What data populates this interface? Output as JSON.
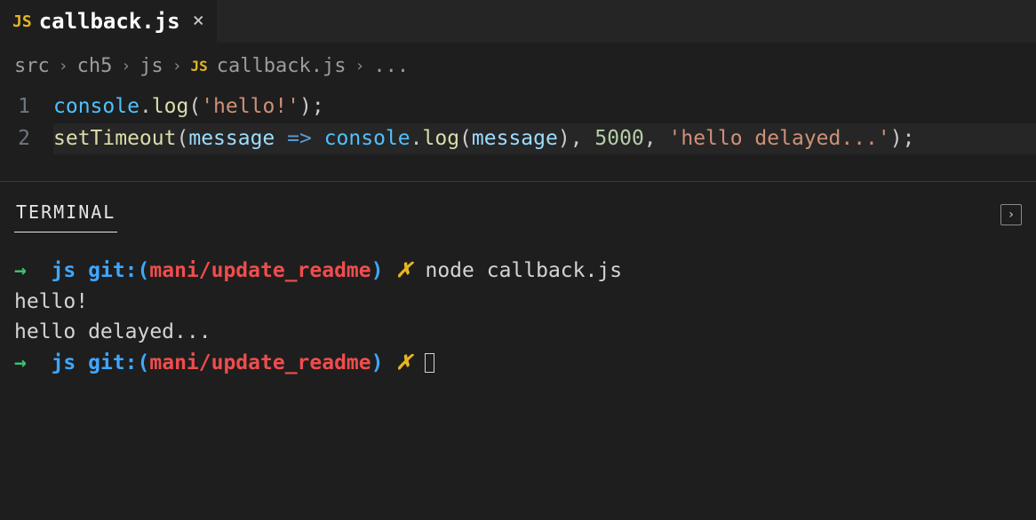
{
  "tab": {
    "icon_label": "JS",
    "filename": "callback.js"
  },
  "breadcrumb": {
    "parts": [
      "src",
      "ch5",
      "js"
    ],
    "file_icon": "JS",
    "filename": "callback.js",
    "trailing": "..."
  },
  "editor": {
    "lines": [
      {
        "num": "1",
        "tokens": [
          {
            "t": "console",
            "c": "tok-obj"
          },
          {
            "t": ".",
            "c": "tok-punct"
          },
          {
            "t": "log",
            "c": "tok-method"
          },
          {
            "t": "(",
            "c": "tok-punct"
          },
          {
            "t": "'hello!'",
            "c": "tok-str"
          },
          {
            "t": ")",
            "c": "tok-punct"
          },
          {
            "t": ";",
            "c": "tok-punct"
          }
        ]
      },
      {
        "num": "2",
        "highlight": true,
        "tokens": [
          {
            "t": "setTimeout",
            "c": "tok-method"
          },
          {
            "t": "(",
            "c": "tok-punct"
          },
          {
            "t": "message",
            "c": "tok-param"
          },
          {
            "t": " ",
            "c": "tok-punct"
          },
          {
            "t": "=>",
            "c": "tok-arrow"
          },
          {
            "t": " ",
            "c": "tok-punct"
          },
          {
            "t": "console",
            "c": "tok-obj"
          },
          {
            "t": ".",
            "c": "tok-punct"
          },
          {
            "t": "log",
            "c": "tok-method"
          },
          {
            "t": "(",
            "c": "tok-punct"
          },
          {
            "t": "message",
            "c": "tok-param"
          },
          {
            "t": ")",
            "c": "tok-punct"
          },
          {
            "t": ", ",
            "c": "tok-punct"
          },
          {
            "t": "5000",
            "c": "tok-num"
          },
          {
            "t": ", ",
            "c": "tok-punct"
          },
          {
            "t": "'hello delayed...'",
            "c": "tok-str"
          },
          {
            "t": ")",
            "c": "tok-punct"
          },
          {
            "t": ";",
            "c": "tok-punct"
          }
        ]
      }
    ]
  },
  "terminal": {
    "tab_label": "TERMINAL",
    "prompt": {
      "arrow": "→",
      "dir": "js",
      "git_label": "git:",
      "branch": "mani/update_readme",
      "dirty_marker": "✗"
    },
    "command": "node callback.js",
    "output": [
      "hello!",
      "hello delayed..."
    ]
  }
}
